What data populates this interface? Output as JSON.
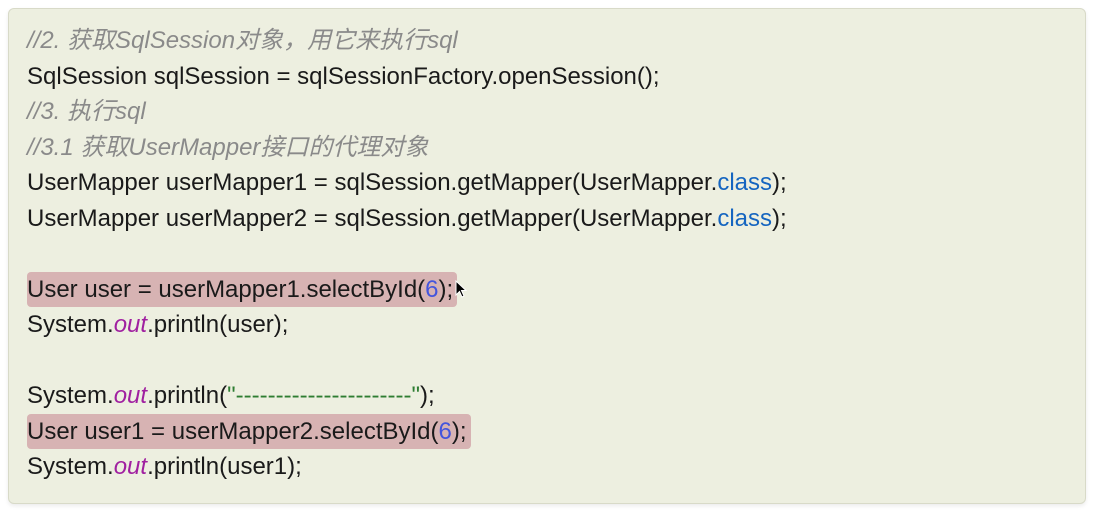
{
  "code": {
    "comment1": "//2. 获取SqlSession对象，用它来执行sql",
    "line2": "SqlSession sqlSession = sqlSessionFactory.openSession();",
    "comment3": "//3. 执行sql",
    "comment4": "//3.1 获取UserMapper接口的代理对象",
    "line5_pre": "UserMapper userMapper1 = sqlSession.getMapper(UserMapper.",
    "line5_kw": "class",
    "line5_post": ");",
    "line6_pre": "UserMapper userMapper2 = sqlSession.getMapper(UserMapper.",
    "line6_kw": "class",
    "line6_post": ");",
    "line8_hl_pre": "User user = userMapper1.selectById(",
    "line8_num": "6",
    "line8_hl_post": ")",
    "line8_after": ";",
    "line9_a": "System.",
    "line9_field": "out",
    "line9_b": ".println(user);",
    "line11_a": "System.",
    "line11_field": "out",
    "line11_b": ".println(",
    "line11_str_open": "\"",
    "line11_str_body": "----------------------",
    "line11_str_close": "\"",
    "line11_c": ");",
    "line12_hl_pre": "User user1 = userMapper2.selectById(",
    "line12_num": "6",
    "line12_hl_post": ");",
    "line13_a": "System.",
    "line13_field": "out",
    "line13_b": ".println(user1);"
  }
}
